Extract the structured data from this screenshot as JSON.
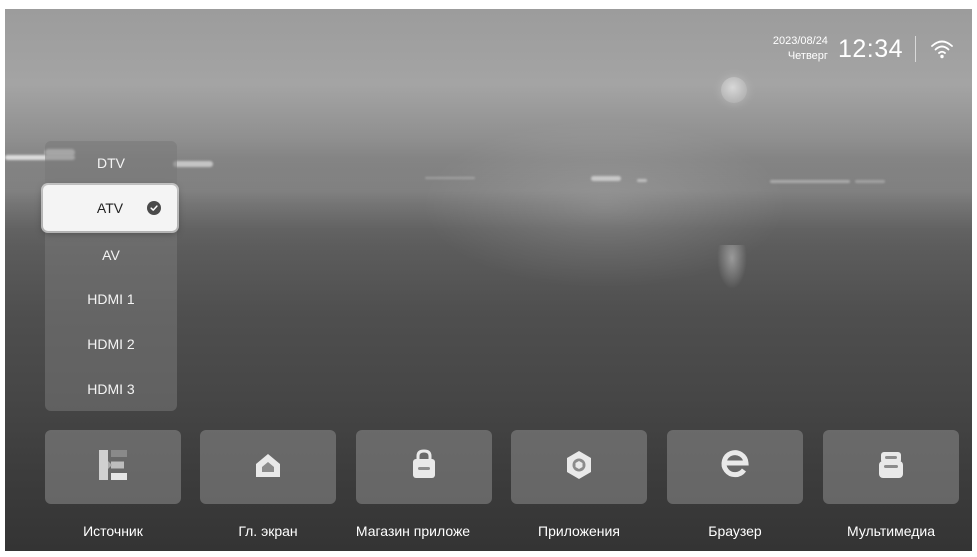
{
  "status_bar": {
    "date": "2023/08/24",
    "weekday": "Четверг",
    "time": "12:34",
    "wifi_icon": "wifi-icon"
  },
  "source_menu": {
    "items": [
      {
        "label": "DTV",
        "selected": false
      },
      {
        "label": "ATV",
        "selected": true
      },
      {
        "label": "AV",
        "selected": false
      },
      {
        "label": "HDMI 1",
        "selected": false
      },
      {
        "label": "HDMI 2",
        "selected": false
      },
      {
        "label": "HDMI 3",
        "selected": false
      }
    ],
    "selected_icon": "checkmark-icon"
  },
  "dock": {
    "items": [
      {
        "label": "Источник",
        "icon": "source-icon"
      },
      {
        "label": "Гл. экран",
        "icon": "home-icon"
      },
      {
        "label": "Магазин приложе",
        "icon": "app-store-icon"
      },
      {
        "label": "Приложения",
        "icon": "apps-icon"
      },
      {
        "label": "Браузер",
        "icon": "browser-icon"
      },
      {
        "label": "Мультимедиа",
        "icon": "multimedia-icon"
      }
    ]
  }
}
